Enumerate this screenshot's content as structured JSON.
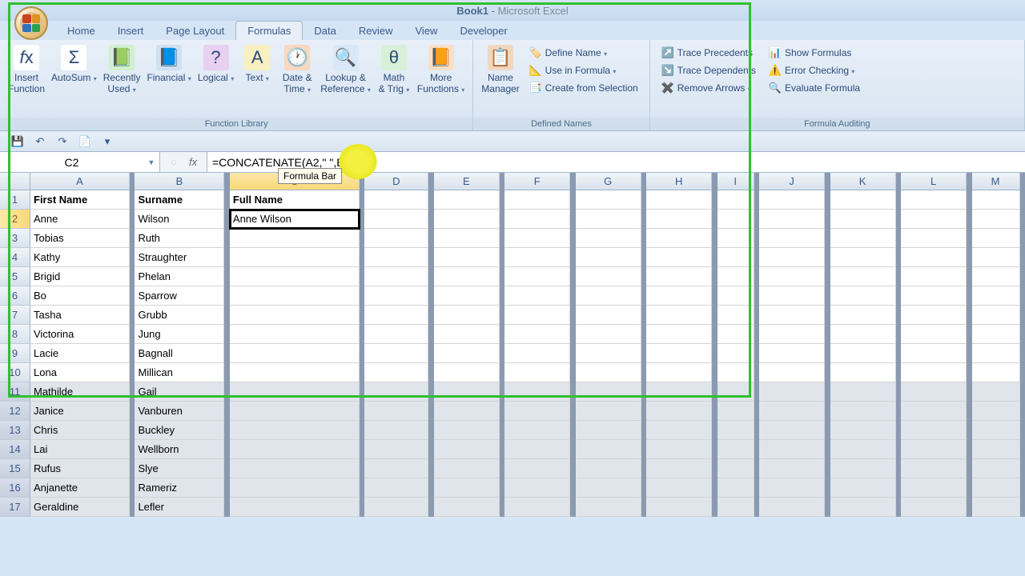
{
  "window": {
    "title": "Book1",
    "app": "Microsoft Excel"
  },
  "tabs": [
    "Home",
    "Insert",
    "Page Layout",
    "Formulas",
    "Data",
    "Review",
    "View",
    "Developer"
  ],
  "active_tab": 3,
  "ribbon": {
    "function_library": {
      "label": "Function Library",
      "buttons": [
        {
          "label": "Insert\nFunction",
          "icon": "fx"
        },
        {
          "label": "AutoSum",
          "icon": "Σ",
          "dd": true
        },
        {
          "label": "Recently\nUsed",
          "icon": "📗",
          "dd": true
        },
        {
          "label": "Financial",
          "icon": "📘",
          "dd": true
        },
        {
          "label": "Logical",
          "icon": "?",
          "dd": true
        },
        {
          "label": "Text",
          "icon": "A",
          "dd": true
        },
        {
          "label": "Date &\nTime",
          "icon": "🕐",
          "dd": true
        },
        {
          "label": "Lookup &\nReference",
          "icon": "🔍",
          "dd": true
        },
        {
          "label": "Math\n& Trig",
          "icon": "θ",
          "dd": true
        },
        {
          "label": "More\nFunctions",
          "icon": "📙",
          "dd": true
        }
      ]
    },
    "defined_names": {
      "label": "Defined Names",
      "manager": "Name\nManager",
      "items": [
        "Define Name",
        "Use in Formula",
        "Create from Selection"
      ]
    },
    "formula_auditing": {
      "label": "Formula Auditing",
      "left": [
        "Trace Precedents",
        "Trace Dependents",
        "Remove Arrows"
      ],
      "right": [
        "Show Formulas",
        "Error Checking",
        "Evaluate Formula"
      ]
    }
  },
  "namebox": "C2",
  "formula": "=CONCATENATE(A2,\" \",B2)",
  "tooltip": "Formula Bar",
  "columns": [
    "A",
    "B",
    "C",
    "D",
    "E",
    "F",
    "G",
    "H",
    "I",
    "J",
    "K",
    "L",
    "M"
  ],
  "col_classes": [
    "col-A",
    "col-B",
    "col-C",
    "col-D",
    "col-E",
    "col-F",
    "col-G",
    "col-H",
    "col-I",
    "col-J",
    "col-K",
    "col-L",
    "col-M"
  ],
  "selected_col": 2,
  "selected_row": 1,
  "headers": [
    "First Name",
    "Surname",
    "Full Name"
  ],
  "rows": [
    {
      "n": 1,
      "first": "First Name",
      "sur": "Surname",
      "full": "Full Name",
      "hdr": true
    },
    {
      "n": 2,
      "first": "Anne",
      "sur": "Wilson",
      "full": "Anne Wilson",
      "sel": true
    },
    {
      "n": 3,
      "first": "Tobias",
      "sur": "Ruth",
      "full": ""
    },
    {
      "n": 4,
      "first": "Kathy",
      "sur": "Straughter",
      "full": ""
    },
    {
      "n": 5,
      "first": "Brigid",
      "sur": "Phelan",
      "full": ""
    },
    {
      "n": 6,
      "first": "Bo",
      "sur": "Sparrow",
      "full": ""
    },
    {
      "n": 7,
      "first": "Tasha",
      "sur": "Grubb",
      "full": ""
    },
    {
      "n": 8,
      "first": "Victorina",
      "sur": "Jung",
      "full": ""
    },
    {
      "n": 9,
      "first": "Lacie",
      "sur": "Bagnall",
      "full": ""
    },
    {
      "n": 10,
      "first": "Lona",
      "sur": "Millican",
      "full": ""
    },
    {
      "n": 11,
      "first": "Mathilde",
      "sur": "Gail",
      "full": "",
      "dim": true
    },
    {
      "n": 12,
      "first": "Janice",
      "sur": "Vanburen",
      "full": "",
      "dim": true
    },
    {
      "n": 13,
      "first": "Chris",
      "sur": "Buckley",
      "full": "",
      "dim": true
    },
    {
      "n": 14,
      "first": "Lai",
      "sur": "Wellborn",
      "full": "",
      "dim": true
    },
    {
      "n": 15,
      "first": "Rufus",
      "sur": "Slye",
      "full": "",
      "dim": true
    },
    {
      "n": 16,
      "first": "Anjanette",
      "sur": "Rameriz",
      "full": "",
      "dim": true
    },
    {
      "n": 17,
      "first": "Geraldine",
      "sur": "Lefler",
      "full": "",
      "dim": true
    }
  ]
}
